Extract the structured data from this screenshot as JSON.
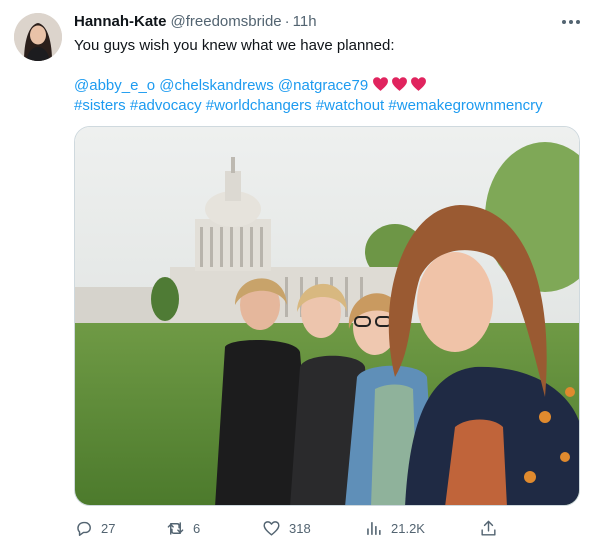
{
  "author": {
    "name": "Hannah-Kate",
    "handle": "@freedomsbride",
    "separator": "·",
    "time": "11h"
  },
  "tweet": {
    "line1": "You guys wish you knew what we have planned:",
    "mentions": [
      "@abby_e_o",
      "@chelskandrews",
      "@natgrace79"
    ],
    "hearts_count": 3,
    "hashtags": [
      "#sisters",
      "#advocacy",
      "#worldchangers",
      "#watchout",
      "#wemakegrownmencry"
    ]
  },
  "media": {
    "description_icon": "photo"
  },
  "actions": {
    "replies": "27",
    "retweets": "6",
    "likes": "318",
    "views": "21.2K"
  },
  "colors": {
    "link": "#1d9bf0",
    "secondary_text": "#536471",
    "heart": "#e0245e",
    "border": "#cfd9de"
  }
}
